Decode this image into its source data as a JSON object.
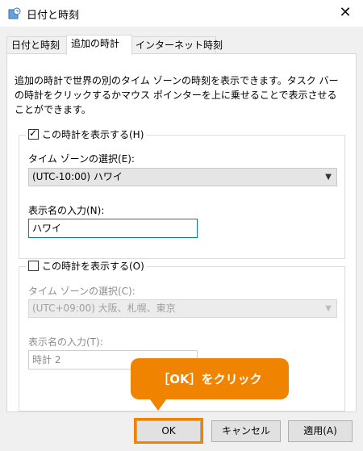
{
  "window": {
    "title": "日付と時刻",
    "close_icon": "close-icon"
  },
  "tabs": [
    {
      "label": "日付と時刻"
    },
    {
      "label": "追加の時計"
    },
    {
      "label": "インターネット時刻"
    }
  ],
  "description": "追加の時計で世界の別のタイム ゾーンの時刻を表示できます。タスク バーの時計をクリックするかマウス ポインターを上に乗せることで表示させることができます。",
  "clock1": {
    "checkbox_label": "この時計を表示する(H)",
    "checked": true,
    "timezone_label": "タイム ゾーンの選択(E):",
    "timezone_value": "(UTC-10:00) ハワイ",
    "name_label": "表示名の入力(N):",
    "name_value": "ハワイ"
  },
  "clock2": {
    "checkbox_label": "この時計を表示する(O)",
    "checked": false,
    "timezone_label": "タイム ゾーンの選択(C):",
    "timezone_value": "(UTC+09:00) 大阪、札幌、東京",
    "name_label": "表示名の入力(T):",
    "name_value": "時計 2"
  },
  "callout": {
    "text": "［OK］をクリック",
    "color": "#f08300"
  },
  "buttons": {
    "ok": "OK",
    "cancel": "キャンセル",
    "apply": "適用(A)"
  }
}
